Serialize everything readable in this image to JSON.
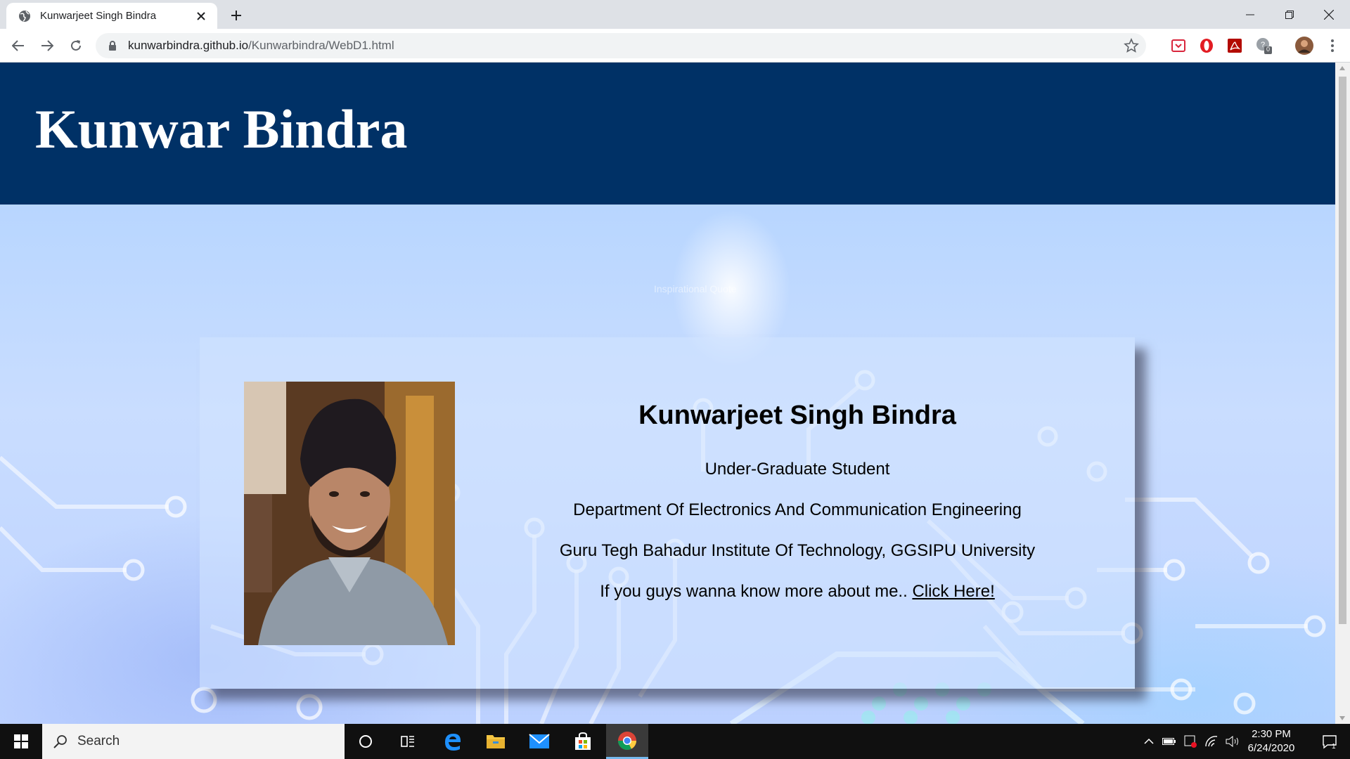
{
  "browser": {
    "tab_title": "Kunwarjeet Singh Bindra",
    "url_host": "kunwarbindra.github.io",
    "url_path": "/Kunwarbindra/WebD1.html",
    "extension_badge": "0"
  },
  "page": {
    "site_title": "Kunwar Bindra",
    "watermark": "Inspirational Quote",
    "profile": {
      "name": "Kunwarjeet Singh Bindra",
      "role": "Under-Graduate Student",
      "department": "Department Of Electronics And Communication Engineering",
      "institute": "Guru Tegh Bahadur Institute Of Technology, GGSIPU University",
      "more_prefix": "If you guys wanna know more about me..",
      "more_link": "Click Here!"
    }
  },
  "taskbar": {
    "search_placeholder": "Search",
    "time": "2:30 PM",
    "date": "6/24/2020",
    "notification_count": "1"
  },
  "colors": {
    "header_bg": "#003166",
    "chrome_tabstrip": "#dee1e6",
    "taskbar_bg": "#101010"
  }
}
